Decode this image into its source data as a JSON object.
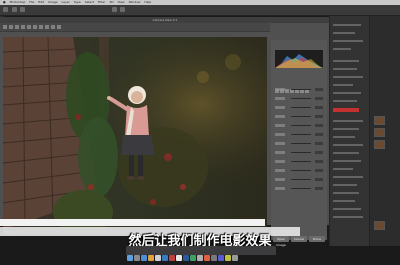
{
  "menubar": {
    "items": [
      "Photoshop",
      "File",
      "Edit",
      "Image",
      "Layer",
      "Type",
      "Select",
      "Filter",
      "3D",
      "View",
      "Window",
      "Help"
    ]
  },
  "dialog": {
    "title": "Camera Raw 9.1",
    "status_left": "100%",
    "open_button": "Open Image",
    "cancel_button": "Cancel",
    "done_button": "Done"
  },
  "subtitle": "然后让我们制作电影效果",
  "colors": {
    "accent_red": "#c4322f",
    "panel_dark": "#333333",
    "dialog_bg": "#505050"
  },
  "icons": [
    "apple-icon",
    "zoom-icon",
    "hand-icon",
    "white-balance-icon",
    "crop-icon",
    "histogram-icon",
    "dock-icons"
  ]
}
